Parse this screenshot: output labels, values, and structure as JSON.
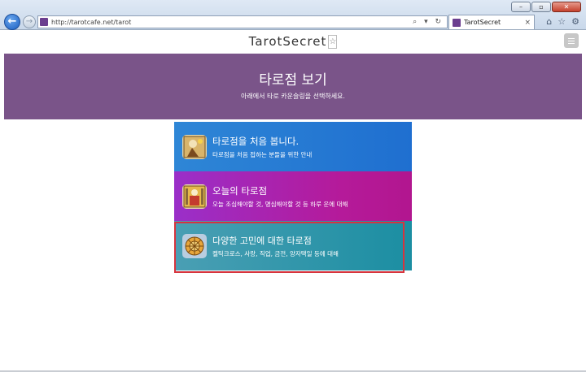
{
  "browser": {
    "url": "http://tarotcafe.net/tarot",
    "address_icons": "⌕ ▾ ↻",
    "tab_title": "TarotSecret",
    "tab_close": "×",
    "window_buttons": [
      "–",
      "▫",
      "✕"
    ],
    "tools": [
      "⌂",
      "☆",
      "⚙"
    ]
  },
  "site": {
    "brand": "TarotSecret",
    "brand_star": "☆"
  },
  "banner": {
    "title": "타로점 보기",
    "subtitle": "아래에서 타로 카운슬링을 선택하세요."
  },
  "cards": [
    {
      "title": "타로점을 처음 봅니다.",
      "subtitle": "타로점을 처음 접하는 분들을 위한 안내",
      "icon": "tarot-card-icon"
    },
    {
      "title": "오늘의 타로점",
      "subtitle": "오늘 조심해야할 것, 명심해야할 것 등 하루 운에 대해",
      "icon": "tarot-card-icon"
    },
    {
      "title": "다양한 고민에 대한 타로점",
      "subtitle": "켈틱크로스, 사랑, 직업, 금전, 양자택일 등에 대해",
      "icon": "wheel-card-icon"
    }
  ],
  "colors": {
    "banner": "#7a5489",
    "card1": "#2e86d6",
    "card2": "#b51a9a",
    "card3": "#1b8ea2",
    "highlight": "#d6343d"
  }
}
